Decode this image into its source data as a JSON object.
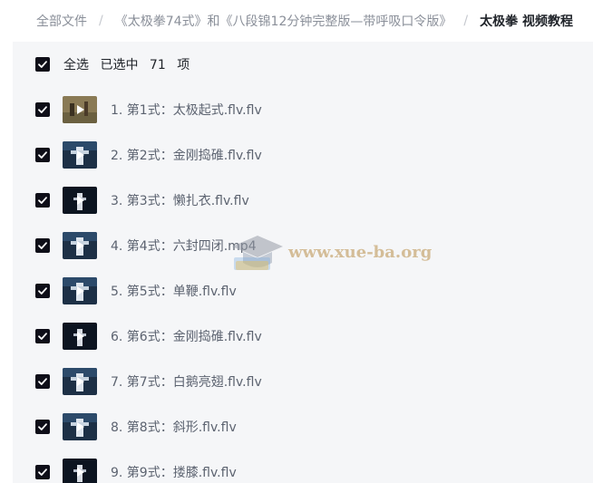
{
  "breadcrumb": [
    {
      "label": "全部文件"
    },
    {
      "label": "《太极拳74式》和《八段锦12分钟完整版—带呼吸口令版》"
    },
    {
      "label": "太极拳 视频教程"
    }
  ],
  "breadcrumb_separator": "/",
  "select_all": {
    "label": "全选",
    "selected_prefix": "已选中",
    "count": "71",
    "unit": "项",
    "checked": true
  },
  "files": [
    {
      "name": "1. 第1式：太极起式.flv.flv",
      "checked": true,
      "thumb": "outdoor"
    },
    {
      "name": "2. 第2式：金刚捣碓.flv.flv",
      "checked": true,
      "thumb": "stage"
    },
    {
      "name": "3. 第3式：懒扎衣.flv.flv",
      "checked": true,
      "thumb": "dark"
    },
    {
      "name": "4. 第4式：六封四闭.mp4",
      "checked": true,
      "thumb": "stage"
    },
    {
      "name": "5. 第5式：单鞭.flv.flv",
      "checked": true,
      "thumb": "stage"
    },
    {
      "name": "6. 第6式：金刚捣碓.flv.flv",
      "checked": true,
      "thumb": "dark"
    },
    {
      "name": "7. 第7式：白鹅亮翅.flv.flv",
      "checked": true,
      "thumb": "stage"
    },
    {
      "name": "8. 第8式：斜形.flv.flv",
      "checked": true,
      "thumb": "stage"
    },
    {
      "name": "9. 第9式：搂膝.flv.flv",
      "checked": true,
      "thumb": "dark"
    }
  ],
  "watermark": {
    "text": "www.xue-ba.org"
  },
  "colors": {
    "checkbox": "#0e0e18",
    "panel_bg": "#f5f6f8",
    "text_primary": "#1f2329",
    "text_secondary": "#5c6370"
  }
}
